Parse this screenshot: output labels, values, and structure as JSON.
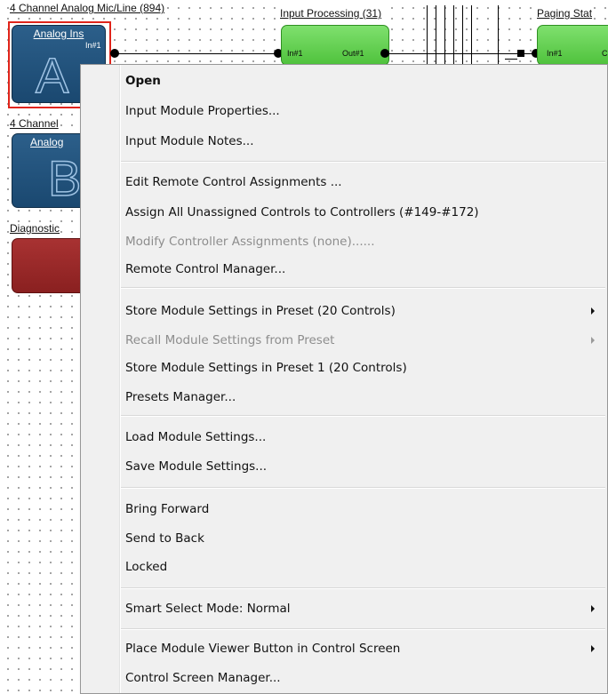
{
  "canvas": {
    "modules": [
      {
        "title": "4 Channel Analog Mic/Line (894)",
        "label": "Analog Ins",
        "letter": "A",
        "port_in": "In#1"
      },
      {
        "title": "4 Channel",
        "label": "Analog",
        "letter": "B"
      },
      {
        "title": "Diagnostic"
      },
      {
        "title": "Input Processing (31)",
        "port_in": "In#1",
        "port_out": "Out#1"
      },
      {
        "title": "Paging Stat",
        "port_in": "In#1",
        "port_out_partial": "C"
      }
    ]
  },
  "menu": {
    "open": "Open",
    "input_module_properties": "Input Module Properties...",
    "input_module_notes": "Input Module Notes...",
    "edit_remote": "Edit Remote Control Assignments ...",
    "assign_all": "Assign All Unassigned Controls to Controllers (#149-#172)",
    "modify_controller": "Modify Controller Assignments (none)......",
    "remote_manager": "Remote Control Manager...",
    "store_preset": "Store Module Settings in Preset (20 Controls)",
    "recall_preset": "Recall Module Settings from Preset",
    "store_preset1": "Store Module Settings in Preset 1 (20 Controls)",
    "presets_manager": "Presets Manager...",
    "load_settings": "Load Module Settings...",
    "save_settings": "Save Module Settings...",
    "bring_forward": "Bring Forward",
    "send_back": "Send to Back",
    "locked": "Locked",
    "smart_select": "Smart Select Mode: Normal",
    "place_viewer": "Place Module Viewer Button in Control Screen",
    "control_screen_manager": "Control Screen Manager..."
  }
}
